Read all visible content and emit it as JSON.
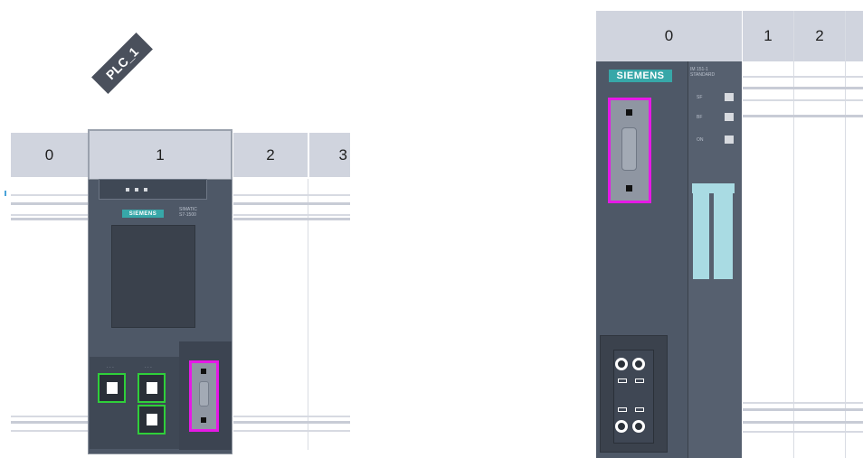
{
  "left_rack": {
    "plc_tag": "PLC_1",
    "slots": [
      "0",
      "1",
      "2",
      "3"
    ]
  },
  "right_rack": {
    "slots": [
      "0",
      "1",
      "2"
    ]
  },
  "cpu_module": {
    "brand": "SIEMENS",
    "model_lines": [
      "SIMATIC",
      "S7-1500"
    ]
  },
  "interface_module": {
    "brand": "SIEMENS",
    "model_lines": [
      "IM 151-1",
      "STANDARD"
    ],
    "led_labels": [
      "SF",
      "BF",
      "ON"
    ]
  }
}
